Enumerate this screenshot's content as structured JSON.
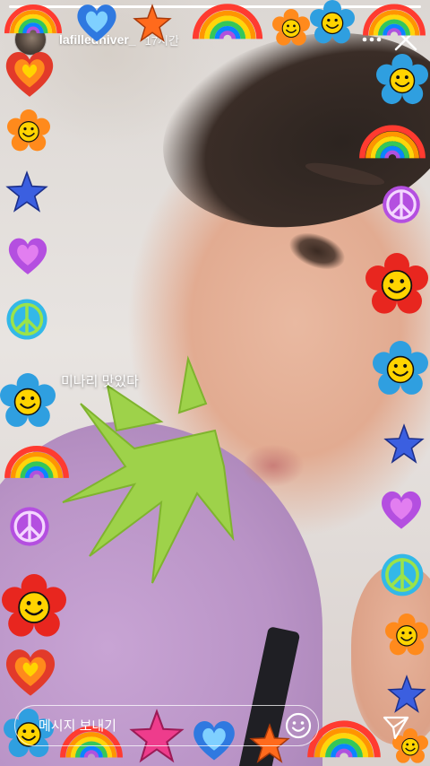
{
  "story": {
    "progress": 1.0,
    "username": "lafilledhiver_",
    "timestamp": "17시간",
    "caption": "미나리 맛있다"
  },
  "header": {
    "more_icon": "more-horizontal-icon",
    "close_icon": "close-icon"
  },
  "reply": {
    "placeholder": "메시지 보내기",
    "emoji_icon": "emoji-icon",
    "send_icon": "send-icon"
  },
  "colors": {
    "text": "#ffffff",
    "smiley_yellow": "#ffd400",
    "flower_red": "#e8261f",
    "flower_blue": "#2f9fe0",
    "heart_red": "#e23a2a",
    "heart_purple": "#b44fe0",
    "star_blue": "#3b5fe0",
    "star_pink": "#ee3c8c"
  }
}
